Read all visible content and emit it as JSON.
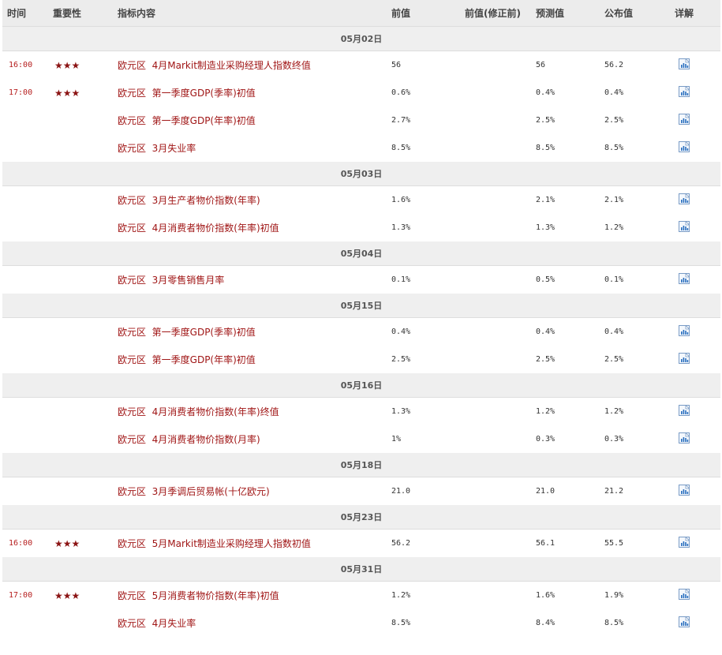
{
  "headers": {
    "time": "时间",
    "importance": "重要性",
    "indicator": "指标内容",
    "prev": "前值",
    "prev_revised": "前值(修正前)",
    "forecast": "预测值",
    "actual": "公布值",
    "detail": "详解"
  },
  "star_glyph": "★★★",
  "groups": [
    {
      "date": "05月02日",
      "rows": [
        {
          "time": "16:00",
          "stars": 3,
          "region": "欧元区",
          "name": "4月Markit制造业采购经理人指数终值",
          "prev": "56",
          "prev_revised": "",
          "forecast": "56",
          "actual": "56.2"
        },
        {
          "time": "17:00",
          "stars": 3,
          "region": "欧元区",
          "name": "第一季度GDP(季率)初值",
          "prev": "0.6%",
          "prev_revised": "",
          "forecast": "0.4%",
          "actual": "0.4%"
        },
        {
          "time": "",
          "stars": 0,
          "region": "欧元区",
          "name": "第一季度GDP(年率)初值",
          "prev": "2.7%",
          "prev_revised": "",
          "forecast": "2.5%",
          "actual": "2.5%"
        },
        {
          "time": "",
          "stars": 0,
          "region": "欧元区",
          "name": "3月失业率",
          "prev": "8.5%",
          "prev_revised": "",
          "forecast": "8.5%",
          "actual": "8.5%"
        }
      ]
    },
    {
      "date": "05月03日",
      "rows": [
        {
          "time": "",
          "stars": 0,
          "region": "欧元区",
          "name": "3月生产者物价指数(年率)",
          "prev": "1.6%",
          "prev_revised": "",
          "forecast": "2.1%",
          "actual": "2.1%"
        },
        {
          "time": "",
          "stars": 0,
          "region": "欧元区",
          "name": "4月消费者物价指数(年率)初值",
          "prev": "1.3%",
          "prev_revised": "",
          "forecast": "1.3%",
          "actual": "1.2%"
        }
      ]
    },
    {
      "date": "05月04日",
      "rows": [
        {
          "time": "",
          "stars": 0,
          "region": "欧元区",
          "name": "3月零售销售月率",
          "prev": "0.1%",
          "prev_revised": "",
          "forecast": "0.5%",
          "actual": "0.1%"
        }
      ]
    },
    {
      "date": "05月15日",
      "rows": [
        {
          "time": "",
          "stars": 0,
          "region": "欧元区",
          "name": "第一季度GDP(季率)初值",
          "prev": "0.4%",
          "prev_revised": "",
          "forecast": "0.4%",
          "actual": "0.4%"
        },
        {
          "time": "",
          "stars": 0,
          "region": "欧元区",
          "name": "第一季度GDP(年率)初值",
          "prev": "2.5%",
          "prev_revised": "",
          "forecast": "2.5%",
          "actual": "2.5%"
        }
      ]
    },
    {
      "date": "05月16日",
      "rows": [
        {
          "time": "",
          "stars": 0,
          "region": "欧元区",
          "name": "4月消费者物价指数(年率)终值",
          "prev": "1.3%",
          "prev_revised": "",
          "forecast": "1.2%",
          "actual": "1.2%"
        },
        {
          "time": "",
          "stars": 0,
          "region": "欧元区",
          "name": "4月消费者物价指数(月率)",
          "prev": "1%",
          "prev_revised": "",
          "forecast": "0.3%",
          "actual": "0.3%"
        }
      ]
    },
    {
      "date": "05月18日",
      "rows": [
        {
          "time": "",
          "stars": 0,
          "region": "欧元区",
          "name": "3月季调后贸易帐(十亿欧元)",
          "prev": "21.0",
          "prev_revised": "",
          "forecast": "21.0",
          "actual": "21.2"
        }
      ]
    },
    {
      "date": "05月23日",
      "rows": [
        {
          "time": "16:00",
          "stars": 3,
          "region": "欧元区",
          "name": "5月Markit制造业采购经理人指数初值",
          "prev": "56.2",
          "prev_revised": "",
          "forecast": "56.1",
          "actual": "55.5"
        }
      ]
    },
    {
      "date": "05月31日",
      "rows": [
        {
          "time": "17:00",
          "stars": 3,
          "region": "欧元区",
          "name": "5月消费者物价指数(年率)初值",
          "prev": "1.2%",
          "prev_revised": "",
          "forecast": "1.6%",
          "actual": "1.9%"
        },
        {
          "time": "",
          "stars": 0,
          "region": "欧元区",
          "name": "4月失业率",
          "prev": "8.5%",
          "prev_revised": "",
          "forecast": "8.4%",
          "actual": "8.5%"
        }
      ]
    }
  ],
  "colors": {
    "accent_red": "#b51c1c",
    "star": "#8b1414",
    "header_bg": "#ececec",
    "date_bg": "#efefef",
    "icon_blue": "#2a6fbf"
  },
  "detail_icon": "chart-report-icon"
}
